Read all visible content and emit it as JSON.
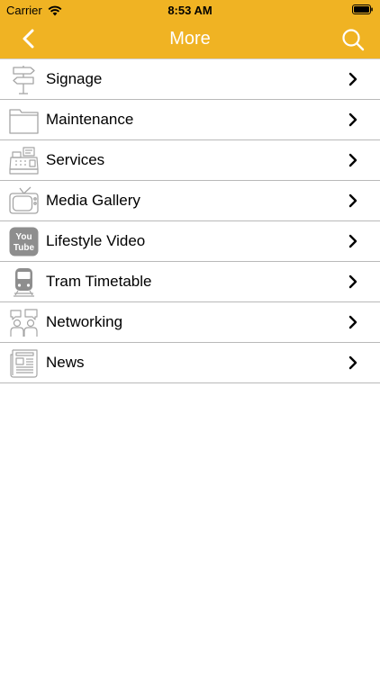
{
  "status": {
    "carrier": "Carrier",
    "time": "8:53 AM"
  },
  "nav": {
    "title": "More"
  },
  "items": [
    {
      "label": "Signage",
      "icon": "signpost-icon"
    },
    {
      "label": "Maintenance",
      "icon": "folder-icon"
    },
    {
      "label": "Services",
      "icon": "cash-register-icon"
    },
    {
      "label": "Media Gallery",
      "icon": "tv-icon"
    },
    {
      "label": "Lifestyle Video",
      "icon": "youtube-icon",
      "icon_text": [
        "You",
        "Tube"
      ]
    },
    {
      "label": "Tram Timetable",
      "icon": "tram-icon"
    },
    {
      "label": "Networking",
      "icon": "people-chat-icon"
    },
    {
      "label": "News",
      "icon": "newspaper-icon"
    }
  ],
  "colors": {
    "header": "#F0B323",
    "title_text": "#FFFFFF",
    "icon_gray": "#A5A5A5",
    "divider": "#B9B9B9"
  }
}
